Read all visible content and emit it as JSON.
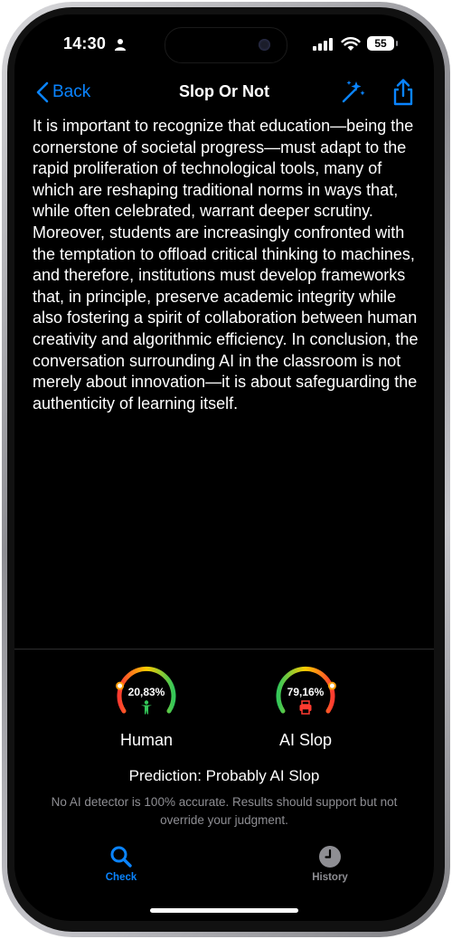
{
  "status_bar": {
    "time": "14:30",
    "battery": "55"
  },
  "nav": {
    "back_label": "Back",
    "title": "Slop Or Not"
  },
  "essay_text": "It is important to recognize that education—being the cornerstone of societal progress—must adapt to the rapid proliferation of technological tools, many of which are reshaping traditional norms in ways that, while often celebrated, warrant deeper scrutiny. Moreover, students are increasingly confronted with the temptation to offload critical thinking to machines, and therefore, institutions must develop frameworks that, in principle, preserve academic integrity while also fostering a spirit of collaboration between human creativity and algorithmic efficiency. In conclusion, the conversation surrounding AI in the classroom is not merely about innovation—it is about safeguarding the authenticity of learning itself.",
  "results": {
    "human": {
      "percent_label": "20,83%",
      "value": 0.2083,
      "label": "Human",
      "icon": "person-icon",
      "color": "#34c759"
    },
    "ai": {
      "percent_label": "79,16%",
      "value": 0.7916,
      "label": "AI Slop",
      "icon": "printer-icon",
      "color": "#ff3b30"
    }
  },
  "prediction": "Prediction: Probably AI Slop",
  "disclaimer": "No AI detector is 100% accurate. Results should support but not override your judgment.",
  "tabs": [
    {
      "label": "Check",
      "icon": "search-icon",
      "active": true
    },
    {
      "label": "History",
      "icon": "clock-icon",
      "active": false
    }
  ],
  "colors": {
    "accent": "#0a84ff",
    "background": "#000000",
    "secondary_text": "#8e8e93"
  }
}
